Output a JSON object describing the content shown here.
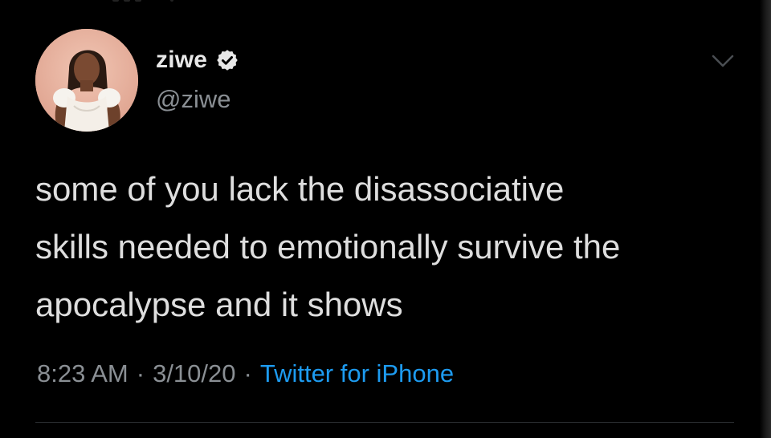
{
  "tweet": {
    "author": {
      "display_name": "ziwe",
      "handle": "@ziwe",
      "verified": true,
      "avatar_icon": "profile-photo"
    },
    "text": "some of you lack the disassociative\nskills needed to emotionally survive the\napocalypse and it shows",
    "meta": {
      "time": "8:23 AM",
      "separator": "·",
      "date": "3/10/20",
      "source": "Twitter for iPhone"
    },
    "menu_icon": "chevron-down-icon"
  },
  "colors": {
    "background": "#000000",
    "text": "#dedede",
    "secondary_text": "#8a8f94",
    "link": "#1d9bf0",
    "verified_badge": "#e8e8e8"
  }
}
